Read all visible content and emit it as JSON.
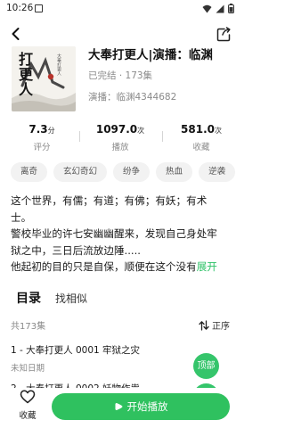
{
  "status_bar": {
    "time": "10:26"
  },
  "book": {
    "title": "大奉打更人|演播：临渊",
    "status": "已完结",
    "separator": " · ",
    "episodes_total": "173集",
    "narrator": "演播：临渊4344682",
    "cover_title": "打更人",
    "cover_small": "大奉打更人"
  },
  "stats": [
    {
      "value": "7.3",
      "unit": "分",
      "label": "评分"
    },
    {
      "value": "1097.0",
      "unit": "次",
      "label": "播放"
    },
    {
      "value": "581.0",
      "unit": "次",
      "label": "收藏"
    }
  ],
  "tags": [
    "离奇",
    "玄幻奇幻",
    "纷争",
    "热血",
    "逆袭"
  ],
  "description": {
    "lines": [
      "这个世界，有儒；有道；有佛；有妖；有术",
      "士。",
      "警校毕业的许七安幽幽醒来，发现自己身处牢",
      "狱之中，三日后流放边陲.....",
      "他起初的目的只是自保，顺便在这个没有"
    ],
    "expand_label": "展开"
  },
  "tabs": {
    "catalog": "目录",
    "similar": "找相似"
  },
  "catalog": {
    "count_label": "共173集",
    "sort_label": "正序",
    "episodes": [
      {
        "title": "1 - 大奉打更人 0001 牢狱之灾",
        "date": "未知日期"
      },
      {
        "title": "2 - 大奉打更人 0002 妖物作祟",
        "date": ""
      }
    ]
  },
  "float_top_label": "顶部",
  "bottom": {
    "collect_label": "收藏",
    "play_label": "开始播放"
  },
  "colors": {
    "accent": "#2fc15f",
    "muted": "#8a8a8a"
  }
}
